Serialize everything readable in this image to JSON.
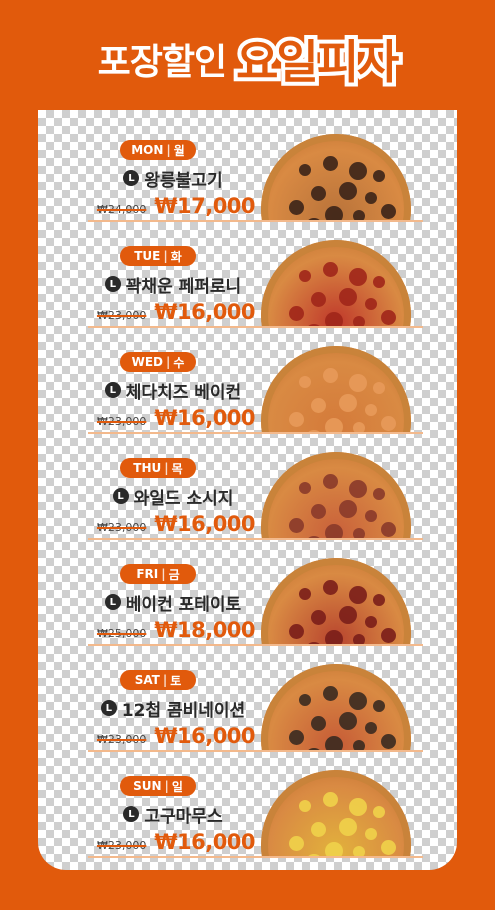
{
  "title": {
    "left": "포장할인",
    "right": "요일피자"
  },
  "size_icon": "L",
  "items": [
    {
      "day_en": "MON",
      "day_ko": "월",
      "name": "왕릉불고기",
      "old_price": "₩24,000",
      "new_price": "₩17,000",
      "pizza_icon": "bulgogi-pizza-icon",
      "color": "#b9733a"
    },
    {
      "day_en": "TUE",
      "day_ko": "화",
      "name": "꽉채운 페퍼로니",
      "old_price": "₩23,000",
      "new_price": "₩16,000",
      "pizza_icon": "pepperoni-pizza-icon",
      "color": "#c0392b"
    },
    {
      "day_en": "WED",
      "day_ko": "수",
      "name": "체다치즈 베이컨",
      "old_price": "₩23,000",
      "new_price": "₩16,000",
      "pizza_icon": "bacon-pizza-icon",
      "color": "#d47a3a"
    },
    {
      "day_en": "THU",
      "day_ko": "목",
      "name": "와일드 소시지",
      "old_price": "₩23,000",
      "new_price": "₩16,000",
      "pizza_icon": "sausage-pizza-icon",
      "color": "#c9603a"
    },
    {
      "day_en": "FRI",
      "day_ko": "금",
      "name": "베이컨 포테이토",
      "old_price": "₩25,000",
      "new_price": "₩18,000",
      "pizza_icon": "potato-pizza-icon",
      "color": "#b8452e"
    },
    {
      "day_en": "SAT",
      "day_ko": "토",
      "name": "12첩 콤비네이션",
      "old_price": "₩23,000",
      "new_price": "₩16,000",
      "pizza_icon": "combination-pizza-icon",
      "color": "#c65b36"
    },
    {
      "day_en": "SUN",
      "day_ko": "일",
      "name": "고구마무스",
      "old_price": "₩23,000",
      "new_price": "₩16,000",
      "pizza_icon": "sweet-potato-pizza-icon",
      "color": "#e2b13c"
    }
  ]
}
